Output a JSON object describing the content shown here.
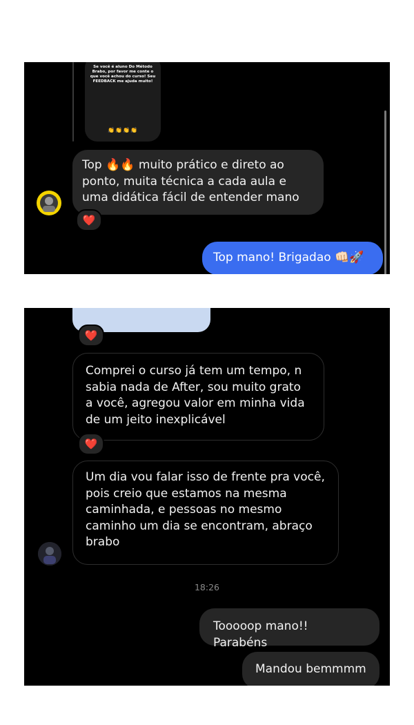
{
  "panel1": {
    "story_text": "Se você é aluno Do Método Brabo, por favor me conte o que você achou do curso! Seu FEEDBACK me ajuda muito!",
    "story_emojis": "👏👏👏👏",
    "message_in": "Top 🔥🔥 muito prático e direto ao ponto, muita técnica a cada aula e uma didática fácil de entender mano",
    "reaction": "❤️",
    "message_out": "Top mano!  Brigadao 👊🏻🚀"
  },
  "panel2": {
    "reaction_image": "❤️",
    "message_in_1": "Comprei o curso já tem um tempo, n sabia nada de After, sou muito grato a você, agregou valor em minha vida de um jeito inexplicável",
    "reaction_1": "❤️",
    "message_in_2": "Um dia vou falar isso de frente pra você, pois creio que estamos na mesma caminhada, e pessoas no mesmo caminho um dia se encontram, abraço brabo",
    "timestamp": "18:26",
    "message_out_1": "Tooooop mano!! Parabéns",
    "message_out_2": "Mandou bemmmm"
  },
  "colors": {
    "chat_bg": "#000000",
    "incoming_bubble": "#262626",
    "outgoing_blue": "#3a6df0",
    "heart": "#ff2d55"
  },
  "icons": [
    "heart-icon",
    "avatar-icon"
  ]
}
